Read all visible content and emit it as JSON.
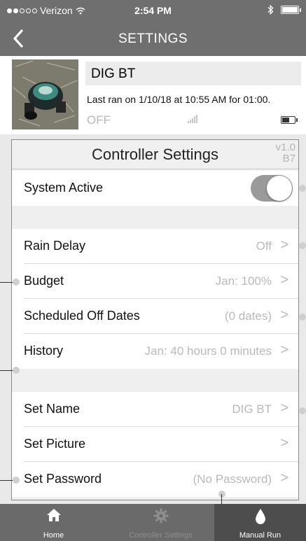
{
  "status_bar": {
    "carrier": "Verizon",
    "time": "2:54 PM",
    "icons": [
      "signal-dots",
      "wifi-icon",
      "bluetooth-icon",
      "battery-icon"
    ]
  },
  "nav": {
    "title": "SETTINGS",
    "back_icon": "chevron-left-icon"
  },
  "device": {
    "name": "DIG BT",
    "last_ran": "Last ran on 1/10/18 at 10:55 AM for 01:00.",
    "state": "OFF",
    "photo_icon": "controller-photo",
    "signal_icon": "signal-bars-icon",
    "battery_icon": "battery-icon"
  },
  "panel": {
    "title": "Controller Settings",
    "version_line1": "v1.0",
    "version_line2": "B7"
  },
  "rows": {
    "system_active": {
      "label": "System Active",
      "toggle_on": true
    },
    "rain_delay": {
      "label": "Rain Delay",
      "value": "Off",
      "chevron": ">"
    },
    "budget": {
      "label": "Budget",
      "value": "Jan: 100%",
      "chevron": ">"
    },
    "scheduled_off": {
      "label": "Scheduled Off Dates",
      "value": "(0 dates)",
      "chevron": ">"
    },
    "history": {
      "label": "History",
      "value": "Jan: 40 hours 0 minutes",
      "chevron": ">"
    },
    "set_name": {
      "label": "Set Name",
      "value": "DIG BT",
      "chevron": ">"
    },
    "set_picture": {
      "label": "Set Picture",
      "value": "",
      "chevron": ">"
    },
    "set_password": {
      "label": "Set Password",
      "value": "(No Password)",
      "chevron": ">"
    }
  },
  "tabs": [
    {
      "label": "Home",
      "icon": "home-icon"
    },
    {
      "label": "Controller Settings",
      "icon": "gear-icon"
    },
    {
      "label": "Manual Run",
      "icon": "water-drop-icon"
    }
  ],
  "colors": {
    "bar_gray": "#6f6f6f",
    "tab_active": "#4d4d4d",
    "muted_text": "#b9b9b9",
    "toggle_track": "#9a9a9a"
  }
}
